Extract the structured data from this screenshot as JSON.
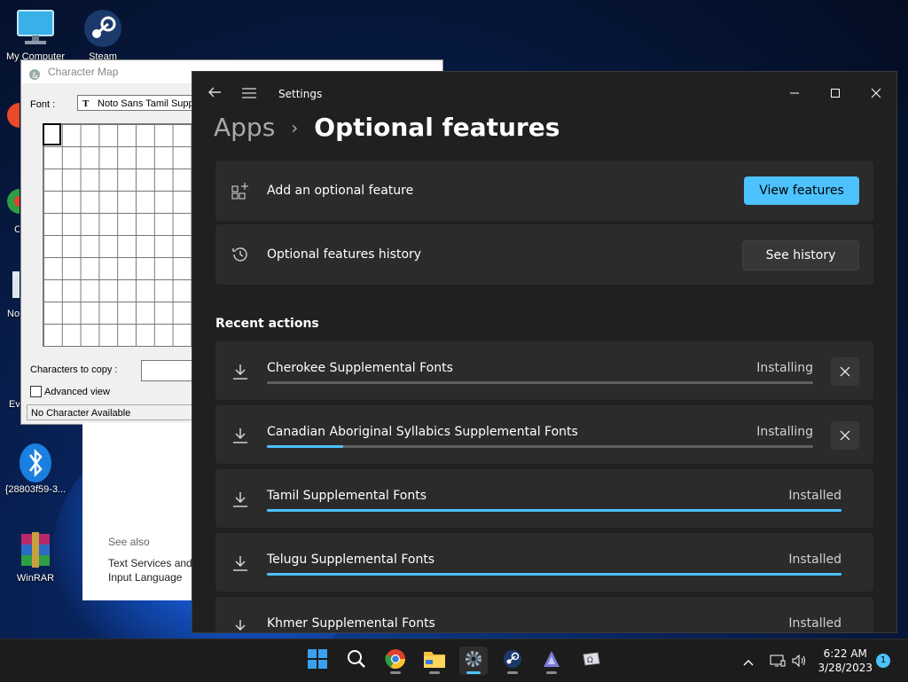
{
  "desktop": {
    "icons": [
      {
        "label": "My Computer"
      },
      {
        "label": "Steam"
      },
      {
        "label": "{28803f59-3..."
      },
      {
        "label": "WinRAR"
      }
    ],
    "partial_labels": [
      "No",
      "Ev",
      "C"
    ]
  },
  "charmap": {
    "title": "Character Map",
    "font_label": "Font :",
    "font_value": "Noto Sans Tamil Supple",
    "copy_label": "Characters to copy :",
    "advanced_label": "Advanced view",
    "status": "No Character Available"
  },
  "see_also": {
    "heading": "See also",
    "link": "Text Services and Input Language"
  },
  "settings": {
    "window_title": "Settings",
    "breadcrumb_parent": "Apps",
    "breadcrumb_current": "Optional features",
    "add_feature": {
      "label": "Add an optional feature",
      "button": "View features"
    },
    "history": {
      "label": "Optional features history",
      "button": "See history"
    },
    "recent_heading": "Recent actions",
    "actions": [
      {
        "name": "Cherokee Supplemental Fonts",
        "status": "Installing",
        "progress": 0.0
      },
      {
        "name": "Canadian Aboriginal Syllabics Supplemental Fonts",
        "status": "Installing",
        "progress": 0.14
      },
      {
        "name": "Tamil Supplemental Fonts",
        "status": "Installed",
        "progress": 1.0
      },
      {
        "name": "Telugu Supplemental Fonts",
        "status": "Installed",
        "progress": 1.0
      },
      {
        "name": "Khmer Supplemental Fonts",
        "status": "Installed",
        "progress": 1.0
      }
    ]
  },
  "taskbar": {
    "time": "6:22 AM",
    "date": "3/28/2023",
    "notification_count": "1"
  },
  "colors": {
    "accent": "#4cc2ff",
    "window_bg": "#202020",
    "card_bg": "#2b2b2b"
  }
}
